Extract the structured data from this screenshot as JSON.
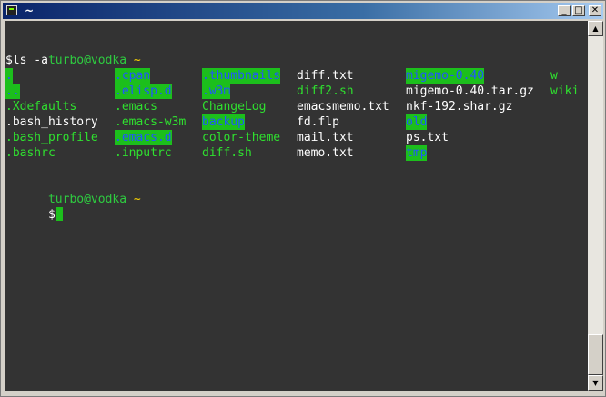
{
  "window": {
    "title": "~"
  },
  "terminal": {
    "prompt_user": "turbo@vodka",
    "prompt_tilde": "~",
    "command": "$ls -a",
    "dollar": "$",
    "rows": [
      [
        ".",
        ".cpan",
        ".thumbnails",
        "diff.txt",
        "migemo-0.40",
        "w"
      ],
      [
        "..",
        ".elisp.d",
        ".w3m",
        "diff2.sh",
        "migemo-0.40.tar.gz",
        "wiki"
      ],
      [
        ".Xdefaults",
        ".emacs",
        "ChangeLog",
        "emacsmemo.txt",
        "nkf-192.shar.gz",
        ""
      ],
      [
        ".bash_history",
        ".emacs-w3m",
        "backup",
        "fd.flp",
        "old",
        ""
      ],
      [
        ".bash_profile",
        ".emacs.d",
        "color-theme",
        "mail.txt",
        "ps.txt",
        ""
      ],
      [
        ".bashrc",
        ".inputrc",
        "diff.sh",
        "memo.txt",
        "tmp",
        ""
      ]
    ]
  },
  "colors": {
    "background": "#333333",
    "user": "#2ecc40",
    "tilde": "#ffd700",
    "highlight": "#1cbf1c"
  }
}
